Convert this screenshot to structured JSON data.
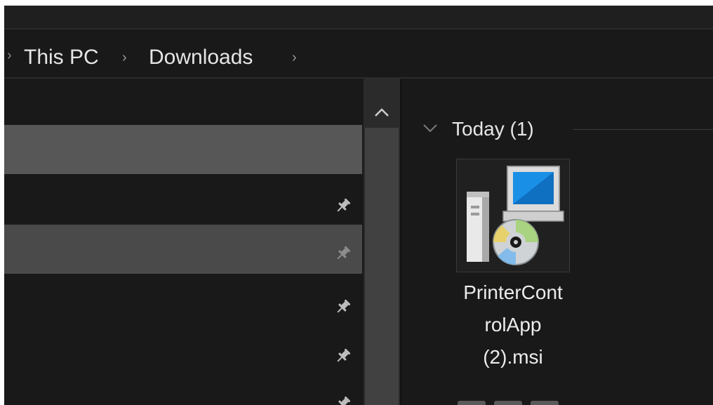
{
  "breadcrumb": {
    "items": [
      "This PC",
      "Downloads"
    ],
    "separator": "›"
  },
  "content": {
    "group": {
      "title": "Today (1)"
    },
    "file": {
      "name": "PrinterControlApp (2).msi",
      "name_lines": [
        "PrinterCont",
        "rolApp",
        "(2).msi"
      ],
      "icon": "msi-installer-icon"
    }
  },
  "colors": {
    "background": "#191919",
    "selected_row": "#575757",
    "text": "#e6e6e6",
    "scrollbar": "#2b2b2b"
  }
}
